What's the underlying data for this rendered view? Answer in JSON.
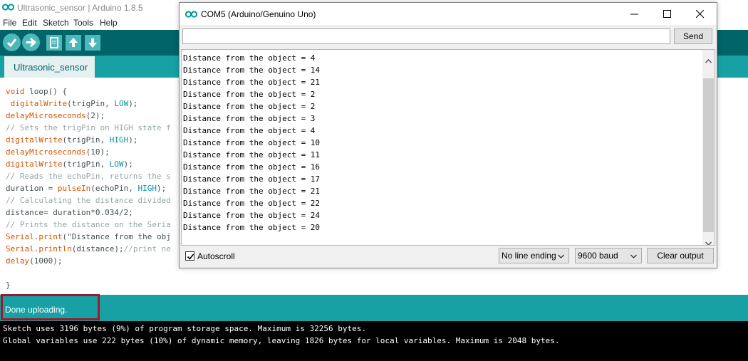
{
  "ide": {
    "title": "Ultrasonic_sensor | Arduino 1.8.5",
    "menu": [
      "File",
      "Edit",
      "Sketch",
      "Tools",
      "Help"
    ],
    "tab_label": "Ultrasonic_sensor",
    "code": {
      "l1a": "void",
      "l1b": " loop() {",
      "l2a": " ",
      "l2b": "digitalWrite",
      "l2c": "(trigPin, ",
      "l2d": "LOW",
      "l2e": ");",
      "l3a": "delayMicroseconds",
      "l3b": "(2);",
      "l4": "// Sets the trigPin on HIGH state f",
      "l5a": "digitalWrite",
      "l5b": "(trigPin, ",
      "l5c": "HIGH",
      "l5d": ");",
      "l6a": "delayMicroseconds",
      "l6b": "(10);",
      "l7a": "digitalWrite",
      "l7b": "(trigPin, ",
      "l7c": "LOW",
      "l7d": ");",
      "l8": "// Reads the echoPin, returns the s",
      "l9a": "duration = ",
      "l9b": "pulseIn",
      "l9c": "(echoPin, ",
      "l9d": "HIGH",
      "l9e": ");",
      "l10": "// Calculating the distance divided",
      "l11": "distance= duration*0.034/2;",
      "l12": "// Prints the distance on the Seria",
      "l13a": "Serial",
      "l13b": ".",
      "l13c": "print",
      "l13d": "(\"Distance from the obj",
      "l14a": "Serial",
      "l14b": ".",
      "l14c": "println",
      "l14d": "(distance);",
      "l14e": "//print ne",
      "l15a": "delay",
      "l15b": "(1000);",
      "l16": "}"
    },
    "status": "Done uploading.",
    "console": [
      "Sketch uses 3196 bytes (9%) of program storage space. Maximum is 32256 bytes.",
      "Global variables use 222 bytes (10%) of dynamic memory, leaving 1826 bytes for local variables. Maximum is 2048 bytes."
    ]
  },
  "serial_monitor": {
    "title": "COM5 (Arduino/Genuino Uno)",
    "input_value": "",
    "send_label": "Send",
    "output": [
      "Distance from the object = 4",
      "Distance from the object = 14",
      "Distance from the object = 21",
      "Distance from the object = 2",
      "Distance from the object = 2",
      "Distance from the object = 3",
      "Distance from the object = 4",
      "Distance from the object = 10",
      "Distance from the object = 11",
      "Distance from the object = 16",
      "Distance from the object = 17",
      "Distance from the object = 21",
      "Distance from the object = 22",
      "Distance from the object = 24",
      "Distance from the object = 20"
    ],
    "autoscroll_label": "Autoscroll",
    "autoscroll_checked": true,
    "line_ending": "No line ending",
    "baud": "9600 baud",
    "clear_label": "Clear output"
  },
  "colors": {
    "toolbar": "#006468",
    "accent": "#17a1a5",
    "button": "#4db7bb",
    "highlight_border": "#9b1b2a"
  }
}
